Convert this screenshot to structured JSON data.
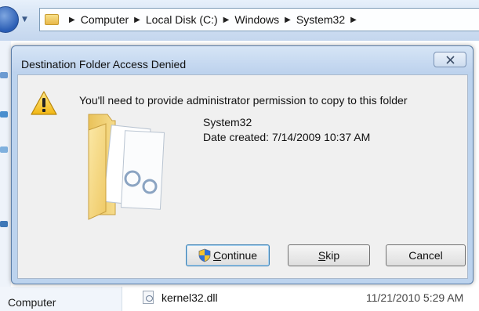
{
  "explorer": {
    "breadcrumbs": [
      "Computer",
      "Local Disk (C:)",
      "Windows",
      "System32"
    ],
    "nav_pane": {
      "computer_label": "Computer"
    },
    "file_row": {
      "name": "kernel32.dll",
      "date_modified": "11/21/2010 5:29 AM"
    }
  },
  "dialog": {
    "title": "Destination Folder Access Denied",
    "close_icon": "close-icon",
    "message": "You'll need to provide administrator permission to copy to this folder",
    "item": {
      "name": "System32",
      "date_created": "Date created: 7/14/2009 10:37 AM"
    },
    "buttons": {
      "continue": "Continue",
      "skip": "Skip",
      "cancel": "Cancel"
    }
  },
  "icons": {
    "warning": "warning-icon",
    "folder": "folder-icon",
    "shield": "uac-shield-icon",
    "back": "back-arrow-icon",
    "dll": "dll-file-icon"
  },
  "colors": {
    "dialog_frame": "#bcd3ee",
    "dialog_body": "#f0f0f0",
    "default_button_border": "#3c7fb1"
  }
}
